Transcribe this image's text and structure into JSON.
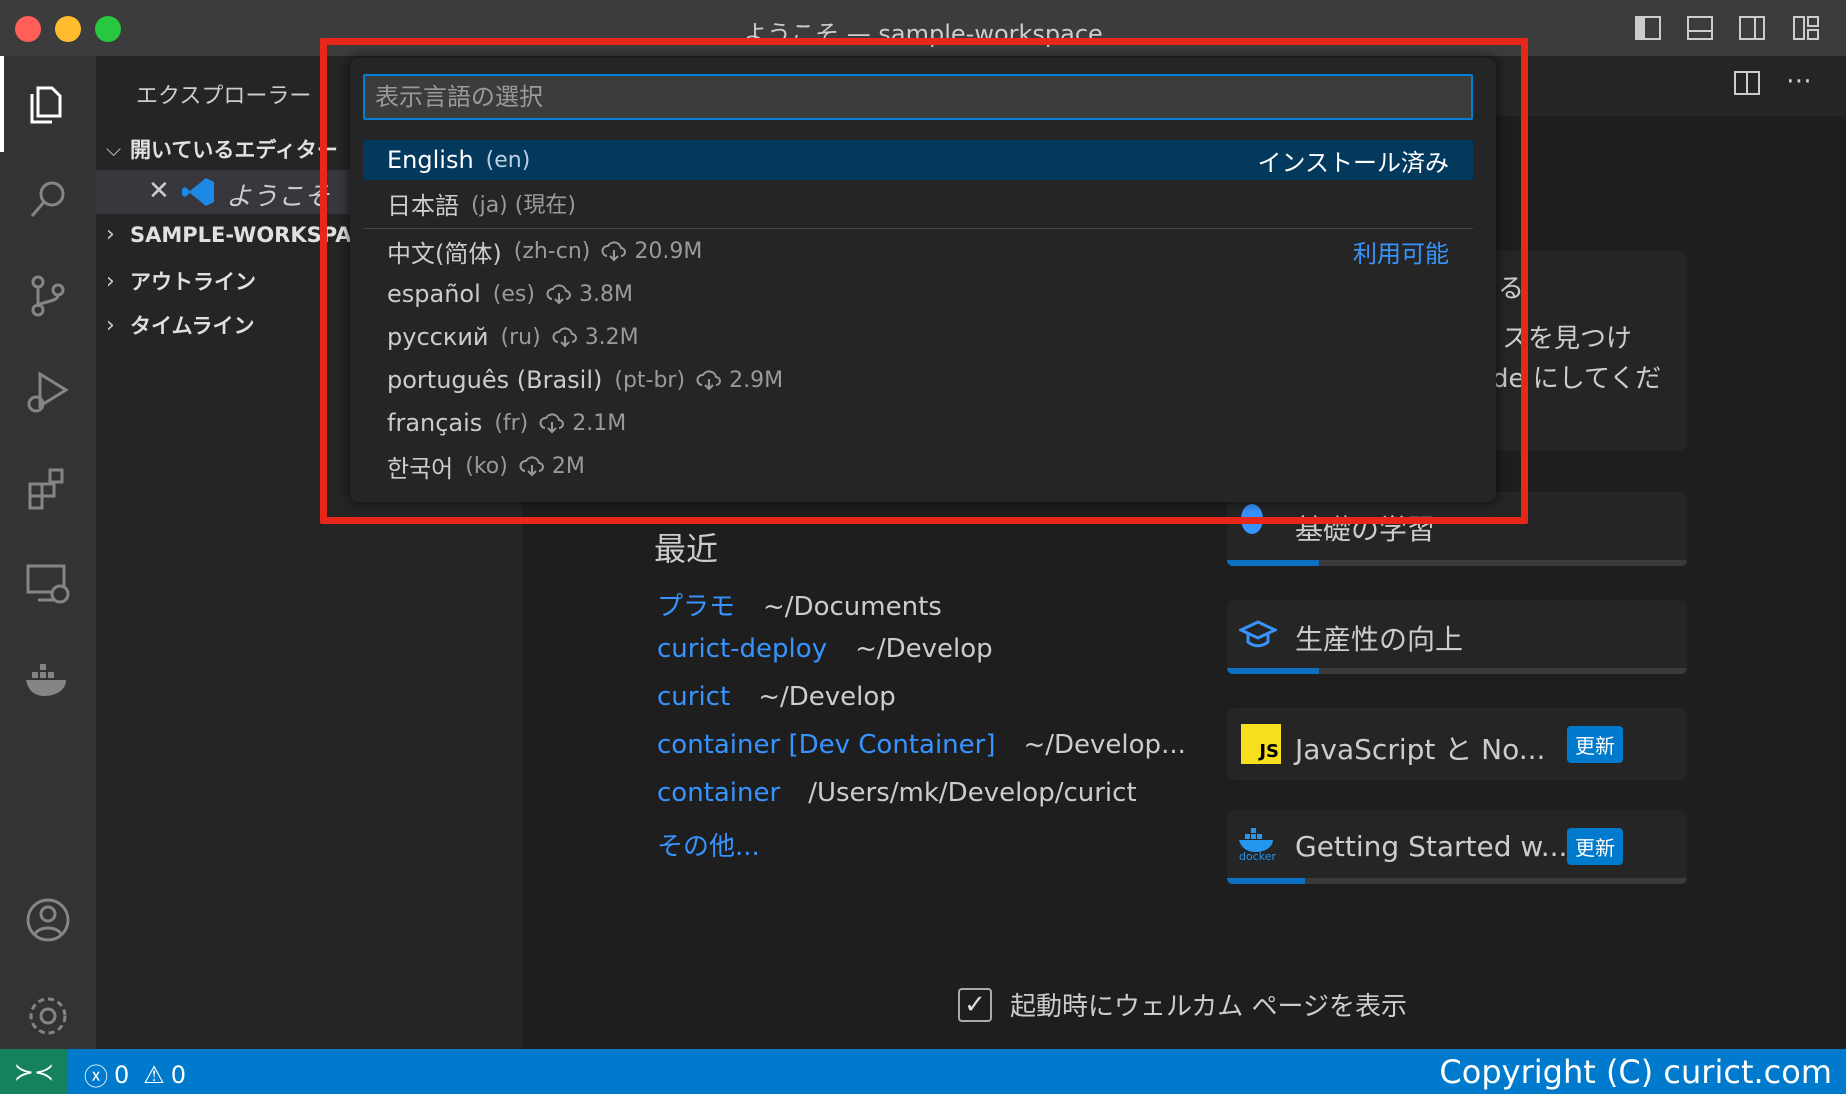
{
  "window": {
    "title": "ようこそ — sample-workspace"
  },
  "sidebar": {
    "header": "エクスプローラー",
    "open_editors": "開いているエディター",
    "open_file": "ようこそ",
    "workspace": "SAMPLE-WORKSPACE",
    "outline": "アウトライン",
    "timeline": "タイムライン"
  },
  "welcome": {
    "recent_heading": "最近",
    "recent": [
      {
        "name": "プラモ",
        "path": "~/Documents"
      },
      {
        "name": "curict-deploy",
        "path": "~/Develop"
      },
      {
        "name": "curict",
        "path": "~/Develop"
      },
      {
        "name": "container [Dev Container]",
        "path": "~/Develop..."
      },
      {
        "name": "container",
        "path": "/Users/mk/Develop/curict"
      }
    ],
    "more": "その他...",
    "partial_text_1": "する",
    "partial_text_2": "スを見つけ",
    "partial_text_3": "de にしてくだ",
    "walkthroughs": [
      {
        "label": "基礎の学習",
        "progress": 0.2
      },
      {
        "label": "生産性の向上",
        "progress": 0.2
      },
      {
        "label": "JavaScript と No...",
        "badge": "更新",
        "icon_text": "JS"
      },
      {
        "label": "Getting Started w...",
        "badge": "更新",
        "icon_text": "docker",
        "progress": 0.17
      }
    ],
    "show_on_startup": "起動時にウェルカム ページを表示"
  },
  "quick_pick": {
    "placeholder": "表示言語の選択",
    "installed_items": [
      {
        "name": "English",
        "code": "(en)",
        "status": "インストール済み"
      },
      {
        "name": "日本語",
        "code": "(ja) (現在)"
      }
    ],
    "available_label": "利用可能",
    "available_items": [
      {
        "name": "中文(简体)",
        "code": "(zh-cn)",
        "size": "20.9M"
      },
      {
        "name": "español",
        "code": "(es)",
        "size": "3.8M"
      },
      {
        "name": "русский",
        "code": "(ru)",
        "size": "3.2M"
      },
      {
        "name": "português (Brasil)",
        "code": "(pt-br)",
        "size": "2.9M"
      },
      {
        "name": "français",
        "code": "(fr)",
        "size": "2.1M"
      },
      {
        "name": "한국어",
        "code": "(ko)",
        "size": "2M"
      }
    ]
  },
  "statusbar": {
    "errors": "0",
    "warnings": "0",
    "copyright": "Copyright (C) curict.com"
  },
  "colors": {
    "accent": "#007acc",
    "highlight_box": "#e8271b",
    "link": "#3794ff"
  }
}
